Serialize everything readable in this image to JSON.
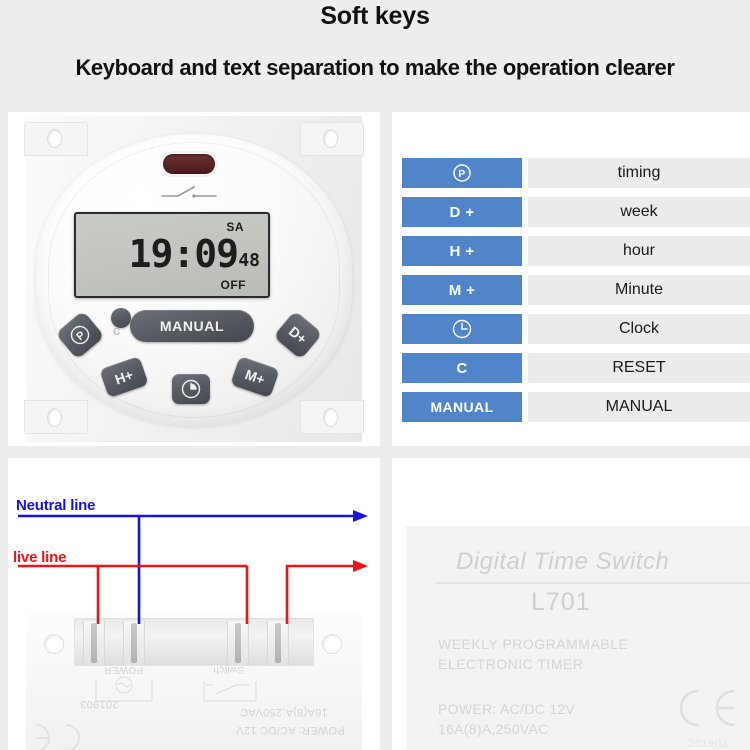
{
  "header": {
    "title": "Soft keys",
    "subtitle": "Keyboard and text separation to make the operation clearer"
  },
  "device": {
    "lcd": {
      "time": "19:09",
      "seconds": "48",
      "day": "SA",
      "state": "OFF"
    },
    "buttons": {
      "p": "P",
      "c": "C",
      "manual": "MANUAL",
      "d_plus": "D+",
      "h_plus": "H+",
      "m_plus": "M+",
      "clock": "clock-icon"
    },
    "ir_window": "infrared-window",
    "switch_symbol": "switch-symbol-icon"
  },
  "key_table": {
    "rows": [
      {
        "key": "P",
        "key_icon": "circled-p-icon",
        "function": "timing"
      },
      {
        "key": "D +",
        "key_icon": "",
        "function": "week"
      },
      {
        "key": "H +",
        "key_icon": "",
        "function": "hour"
      },
      {
        "key": "M +",
        "key_icon": "",
        "function": "Minute"
      },
      {
        "key": "",
        "key_icon": "clock-icon",
        "function": "Clock"
      },
      {
        "key": "C",
        "key_icon": "",
        "function": "RESET"
      },
      {
        "key": "MANUAL",
        "key_icon": "",
        "function": "MANUAL"
      }
    ],
    "key_color": "#5185c9",
    "function_bg": "#ebebeb"
  },
  "wiring": {
    "neutral_label": "Neutral line",
    "live_label": "live line",
    "neutral_color": "#1414dc",
    "live_color": "#ee1414",
    "terminals": {
      "power_label": "POWER",
      "switch_label": "Switch",
      "serial": "201903",
      "rating": "16A(8)A,250VAC",
      "power_spec": "POWER: AC/DC 12V"
    }
  },
  "product_label": {
    "title": "Digital Time Switch",
    "model": "L701",
    "desc_line1": "WEEKLY PROGRAMMABLE",
    "desc_line2": "ELECTRONIC TIMER",
    "power_line1": "POWER: AC/DC 12V",
    "power_line2": "16A(8)A,250VAC",
    "ce_mark": "ce-mark-icon",
    "serial": "201903"
  }
}
